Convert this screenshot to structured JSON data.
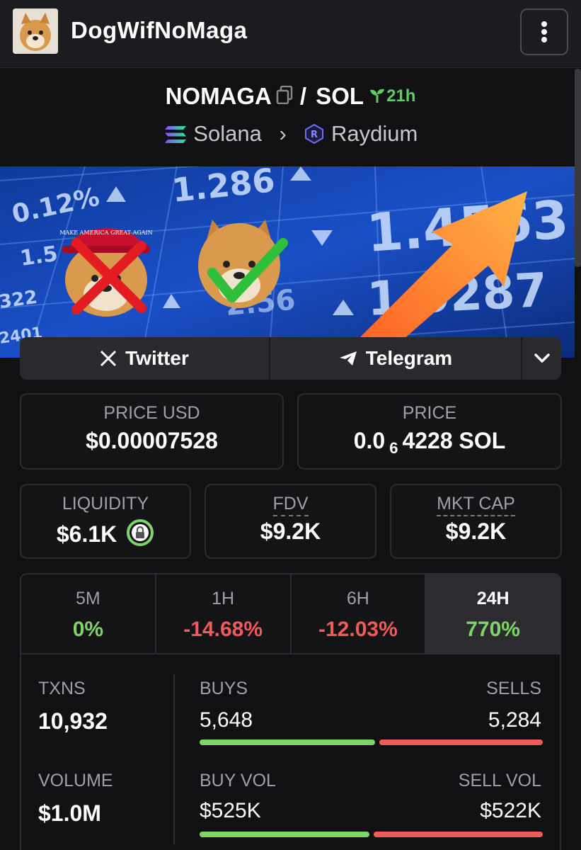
{
  "header": {
    "title": "DogWifNoMaga",
    "menu_icon": "more-vertical-icon"
  },
  "pair": {
    "base": "NOMAGA",
    "separator": "/",
    "quote": "SOL",
    "age": "21h",
    "chain": "Solana",
    "dex": "Raydium"
  },
  "banner": {
    "numbers": [
      "0.12%",
      "1.286",
      "1.4563",
      "1.0287",
      "1.5",
      "2.56",
      "322",
      "2401"
    ],
    "hat_text": "MAKE AMERICA GREAT AGAIN"
  },
  "socials": {
    "twitter": "Twitter",
    "telegram": "Telegram"
  },
  "price": {
    "usd_label": "PRICE USD",
    "usd_value": "$0.00007528",
    "native_label": "PRICE",
    "native_prefix": "0.0",
    "native_sub": "6",
    "native_digits": "4228",
    "native_unit": "SOL"
  },
  "metrics": {
    "liquidity_label": "LIQUIDITY",
    "liquidity_value": "$6.1K",
    "fdv_label": "FDV",
    "fdv_value": "$9.2K",
    "mktcap_label": "MKT CAP",
    "mktcap_value": "$9.2K"
  },
  "timeframes": [
    {
      "label": "5M",
      "value": "0%"
    },
    {
      "label": "1H",
      "value": "-14.68%"
    },
    {
      "label": "6H",
      "value": "-12.03%"
    },
    {
      "label": "24H",
      "value": "770%"
    }
  ],
  "stats": {
    "txns_label": "TXNS",
    "txns_value": "10,932",
    "buys_label": "BUYS",
    "buys_value": "5,648",
    "sells_label": "SELLS",
    "sells_value": "5,284",
    "buy_share": 0.517,
    "volume_label": "VOLUME",
    "volume_value": "$1.0M",
    "buyvol_label": "BUY VOL",
    "buyvol_value": "$525K",
    "sellvol_label": "SELL VOL",
    "sellvol_value": "$522K",
    "buyvol_share": 0.501
  },
  "colors": {
    "positive": "#7ed36b",
    "negative": "#ef5a5a",
    "age_green": "#5ecb65"
  }
}
